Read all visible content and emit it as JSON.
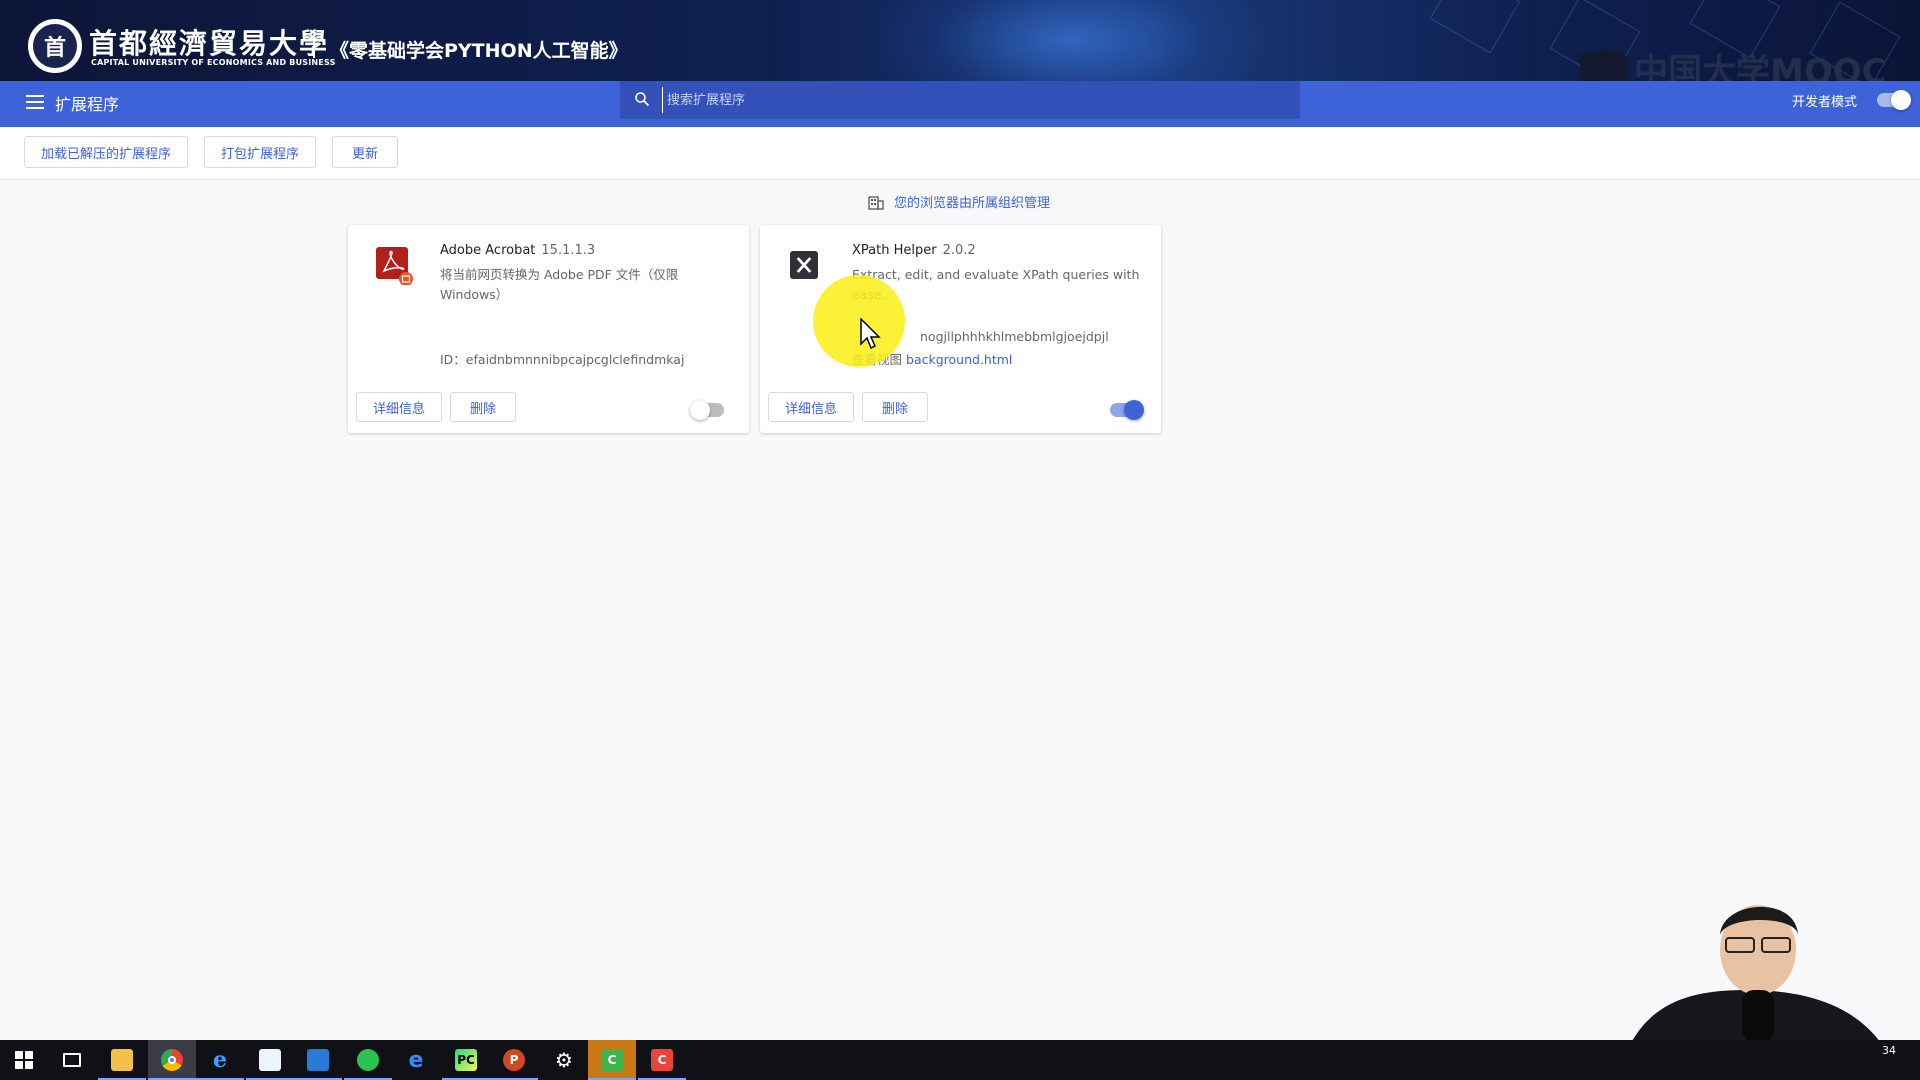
{
  "banner": {
    "university_name": "首都經濟貿易大學",
    "university_sub": "CAPITAL UNIVERSITY OF ECONOMICS AND BUSINESS",
    "course_title": "《零基础学会PYTHON人工智能》",
    "mooc_logo": "中国大学MOOC"
  },
  "toolbar": {
    "title": "扩展程序",
    "search_placeholder": "搜索扩展程序",
    "dev_mode_label": "开发者模式",
    "dev_mode_on": true
  },
  "actions": {
    "load_unpacked": "加载已解压的扩展程序",
    "pack": "打包扩展程序",
    "update": "更新"
  },
  "managed_notice": "您的浏览器由所属组织管理",
  "extensions": [
    {
      "name": "Adobe Acrobat",
      "version": "15.1.1.3",
      "description": "将当前网页转换为 Adobe PDF 文件（仅限 Windows）",
      "id_line": "ID：efaidnbmnnnibpcajpcglclefindmkaj",
      "details_label": "详细信息",
      "remove_label": "删除",
      "enabled": false
    },
    {
      "name": "XPath Helper",
      "version": "2.0.2",
      "description": "Extract, edit, and evaluate XPath queries with ease.",
      "id_fragment": "nogjllphhhkhlmebbmlgjoejdpjl",
      "views_label": "查看视图",
      "views_link": "background.html",
      "details_label": "详细信息",
      "remove_label": "删除",
      "enabled": true
    }
  ],
  "colors": {
    "accent": "#3e63d8",
    "toolbar": "#3e63d8",
    "search_bg": "#3351b9"
  },
  "taskbar": {
    "clock": "34"
  }
}
